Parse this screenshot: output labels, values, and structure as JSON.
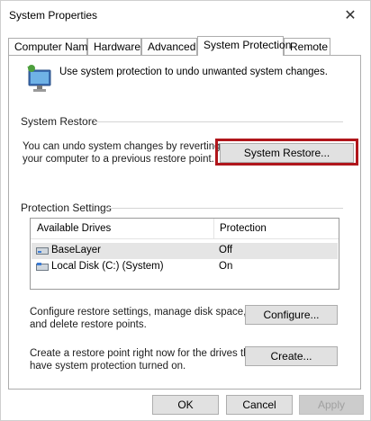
{
  "window": {
    "title": "System Properties"
  },
  "tabs": [
    {
      "label": "Computer Name"
    },
    {
      "label": "Hardware"
    },
    {
      "label": "Advanced"
    },
    {
      "label": "System Protection"
    },
    {
      "label": "Remote"
    }
  ],
  "active_tab": "System Protection",
  "intro_text": "Use system protection to undo unwanted system changes.",
  "system_restore": {
    "group_label": "System Restore",
    "desc_line1": "You can undo system changes by reverting",
    "desc_line2": "your computer to a previous restore point.",
    "button_label": "System Restore..."
  },
  "protection_settings": {
    "group_label": "Protection Settings",
    "columns": [
      "Available Drives",
      "Protection"
    ],
    "rows": [
      {
        "drive": "BaseLayer",
        "protection": "Off",
        "icon": "drive-icon"
      },
      {
        "drive": "Local Disk (C:) (System)",
        "protection": "On",
        "icon": "system-drive-icon"
      }
    ],
    "configure_desc_line1": "Configure restore settings, manage disk space,",
    "configure_desc_line2": "and delete restore points.",
    "configure_label": "Configure...",
    "create_desc_line1": "Create a restore point right now for the drives that",
    "create_desc_line2": "have system protection turned on.",
    "create_label": "Create..."
  },
  "footer": {
    "ok_label": "OK",
    "cancel_label": "Cancel",
    "apply_label": "Apply"
  },
  "colors": {
    "highlight": "#b0161b",
    "button_face": "#e1e1e1",
    "selected_row": "#e5e5e5"
  }
}
